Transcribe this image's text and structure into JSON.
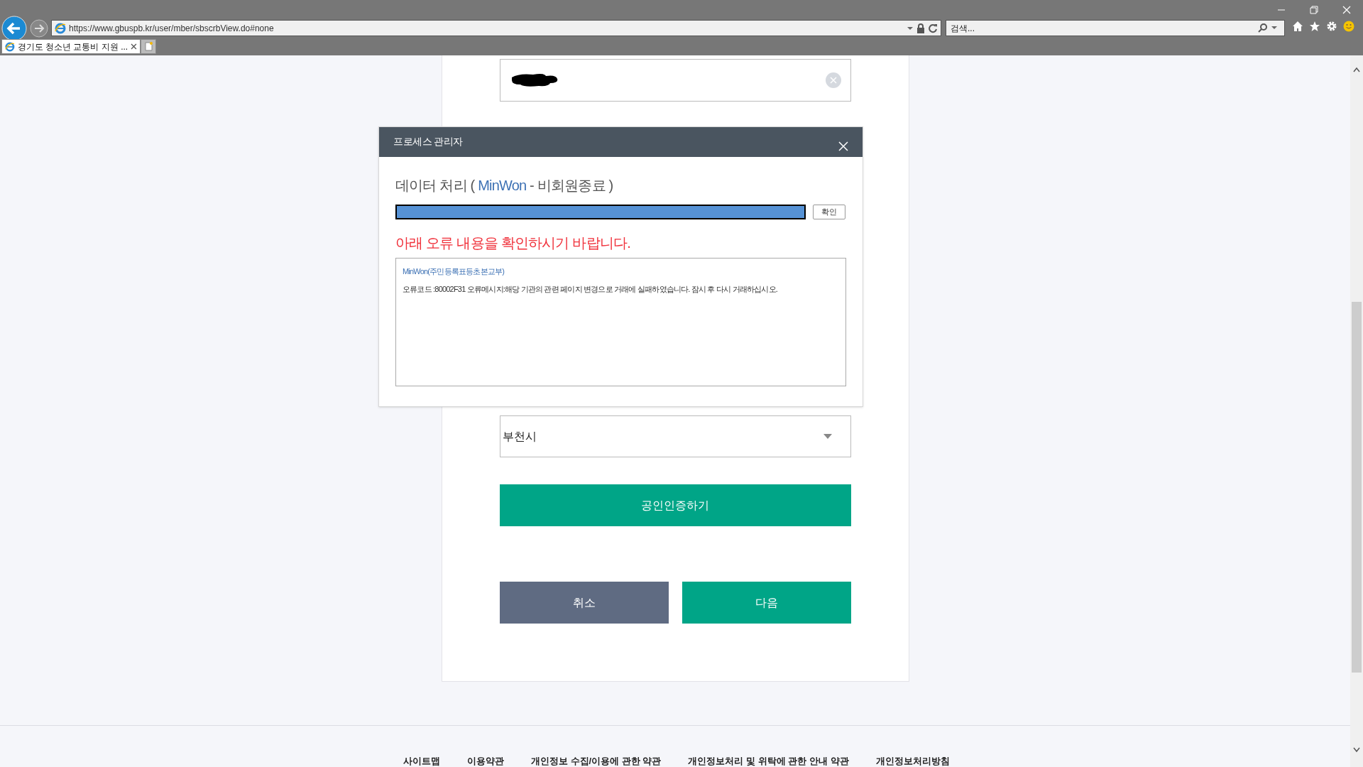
{
  "browser": {
    "url": "https://www.gbuspb.kr/user/mber/sbscrbView.do#none",
    "search": {
      "placeholder": "검색..."
    },
    "tabs": [
      {
        "title": "경기도 청소년 교통비 지원 ...",
        "selected": true
      }
    ]
  },
  "form": {
    "select_value": "부천시",
    "certify_button": "공인인증하기",
    "cancel_button": "취소",
    "next_button": "다음"
  },
  "dialog": {
    "title": "프로세스 관리자",
    "heading": "데이터 처리 (",
    "service": "MinWon",
    "heading_rest": "- 비회원종료 )",
    "progress": {
      "level": 1.0
    },
    "confirm_button": "확인",
    "warning": "아래 오류 내용을 확인하시기 바랍니다.",
    "log_title": "MinWon(주민등록표등초본교부)",
    "log_message": "오류코드 :80002F31 오류메시지:해당 기관의 관련 페이지 변경으로 거래에 실패하였습니다. 잠시 후 다시 거래하십시오."
  },
  "footer_links": [
    "사이트맵",
    "이용약관",
    "개인정보 수집/이용에 관한 약관",
    "개인정보처리 및 위탁에 관한 안내 약관",
    "개인정보처리방침"
  ]
}
